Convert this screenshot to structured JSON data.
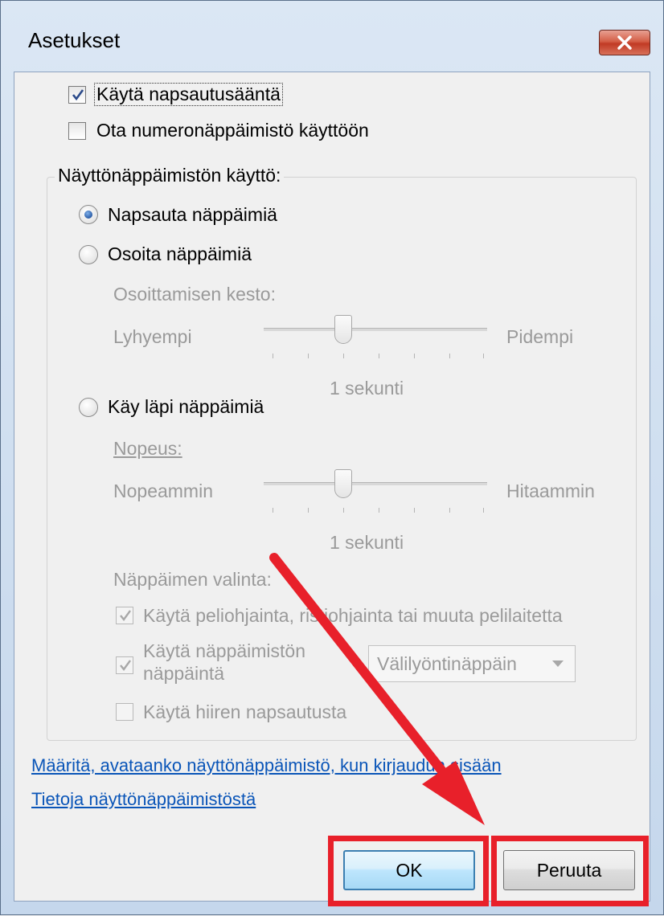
{
  "window": {
    "title": "Asetukset"
  },
  "options": {
    "use_click_sound": {
      "label": "Käytä napsautusääntä",
      "checked": true
    },
    "numeric_keypad": {
      "label": "Ota numeronäppäimistö käyttöön",
      "checked": false
    }
  },
  "group": {
    "legend": "Näyttönäppäimistön käyttö:",
    "modes": [
      {
        "label": "Napsauta näppäimiä",
        "selected": true
      },
      {
        "label": "Osoita näppäimiä",
        "selected": false
      },
      {
        "label": "Käy läpi näppäimiä",
        "selected": false
      }
    ],
    "hover_duration": {
      "label": "Osoittamisen kesto:",
      "min_label": "Lyhyempi",
      "max_label": "Pidempi",
      "value_text": "1 sekunti"
    },
    "scan_speed": {
      "label": "Nopeus:",
      "min_label": "Nopeammin",
      "max_label": "Hitaammin",
      "value_text": "1 sekunti"
    },
    "key_selection": {
      "label": "Näppäimen valinta:",
      "gamepad": {
        "label": "Käytä peliohjainta, ristiohjainta tai muuta pelilaitetta",
        "checked": true
      },
      "keyboard": {
        "label_line1": "Käytä näppäimistön",
        "label_line2": "näppäintä",
        "checked": true
      },
      "key_dropdown": {
        "selected": "Välilyöntinäppäin"
      },
      "mouse_click": {
        "label": "Käytä hiiren napsautusta",
        "checked": false
      }
    }
  },
  "links": {
    "login_setting": "Määritä, avataanko näyttönäppäimistö, kun kirjaudun sisään",
    "about": "Tietoja näyttönäppäimistöstä"
  },
  "buttons": {
    "ok": "OK",
    "cancel": "Peruuta"
  },
  "colors": {
    "highlight": "#e8202a",
    "link": "#0a55b8",
    "accent": "#3c7fb1"
  },
  "annotations": {
    "arrow": "red-arrow-pointing-to-ok-button"
  }
}
